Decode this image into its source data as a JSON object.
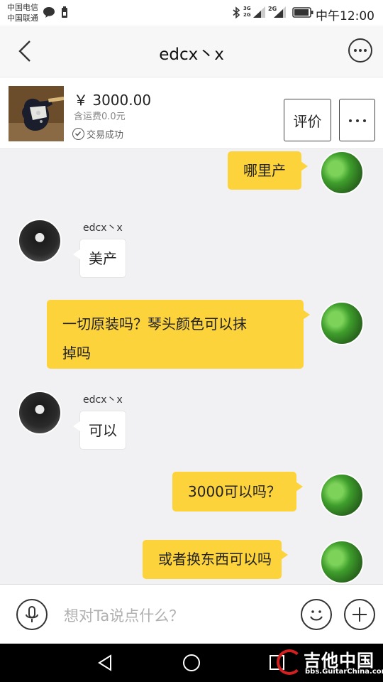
{
  "status_bar": {
    "carrier_1": "中国电信",
    "carrier_2": "中国联通",
    "network_1": "3G 2G",
    "network_2": "2G",
    "time": "中午12:00"
  },
  "header": {
    "title": "edcx丶x",
    "back_icon": "chevron-left-icon",
    "more_icon": "more-dots-icon"
  },
  "product": {
    "price": "￥ 3000.00",
    "shipping": "含运费0.0元",
    "status": "交易成功",
    "review_label": "评价",
    "more_label": "..."
  },
  "messages": [
    {
      "from": "me",
      "text": "哪里产"
    },
    {
      "from": "seller",
      "sender": "edcx丶x",
      "text": "美产"
    },
    {
      "from": "me",
      "text_line1": "一切原装吗？琴头颜色可以抹",
      "text_line2": "掉吗"
    },
    {
      "from": "seller",
      "sender": "edcx丶x",
      "text": "可以"
    },
    {
      "from": "me",
      "text": "3000可以吗？"
    },
    {
      "from": "me",
      "text": "或者换东西可以吗"
    }
  ],
  "input": {
    "placeholder": "想对Ta说点什么？"
  },
  "watermark": {
    "main": "吉他中国",
    "sub": "bbs.GuitarChina.com"
  },
  "colors": {
    "bubble_me": "#fdd33c",
    "bubble_seller": "#ffffff",
    "background": "#f1f1f3",
    "watermark_red": "#d21f1f"
  }
}
